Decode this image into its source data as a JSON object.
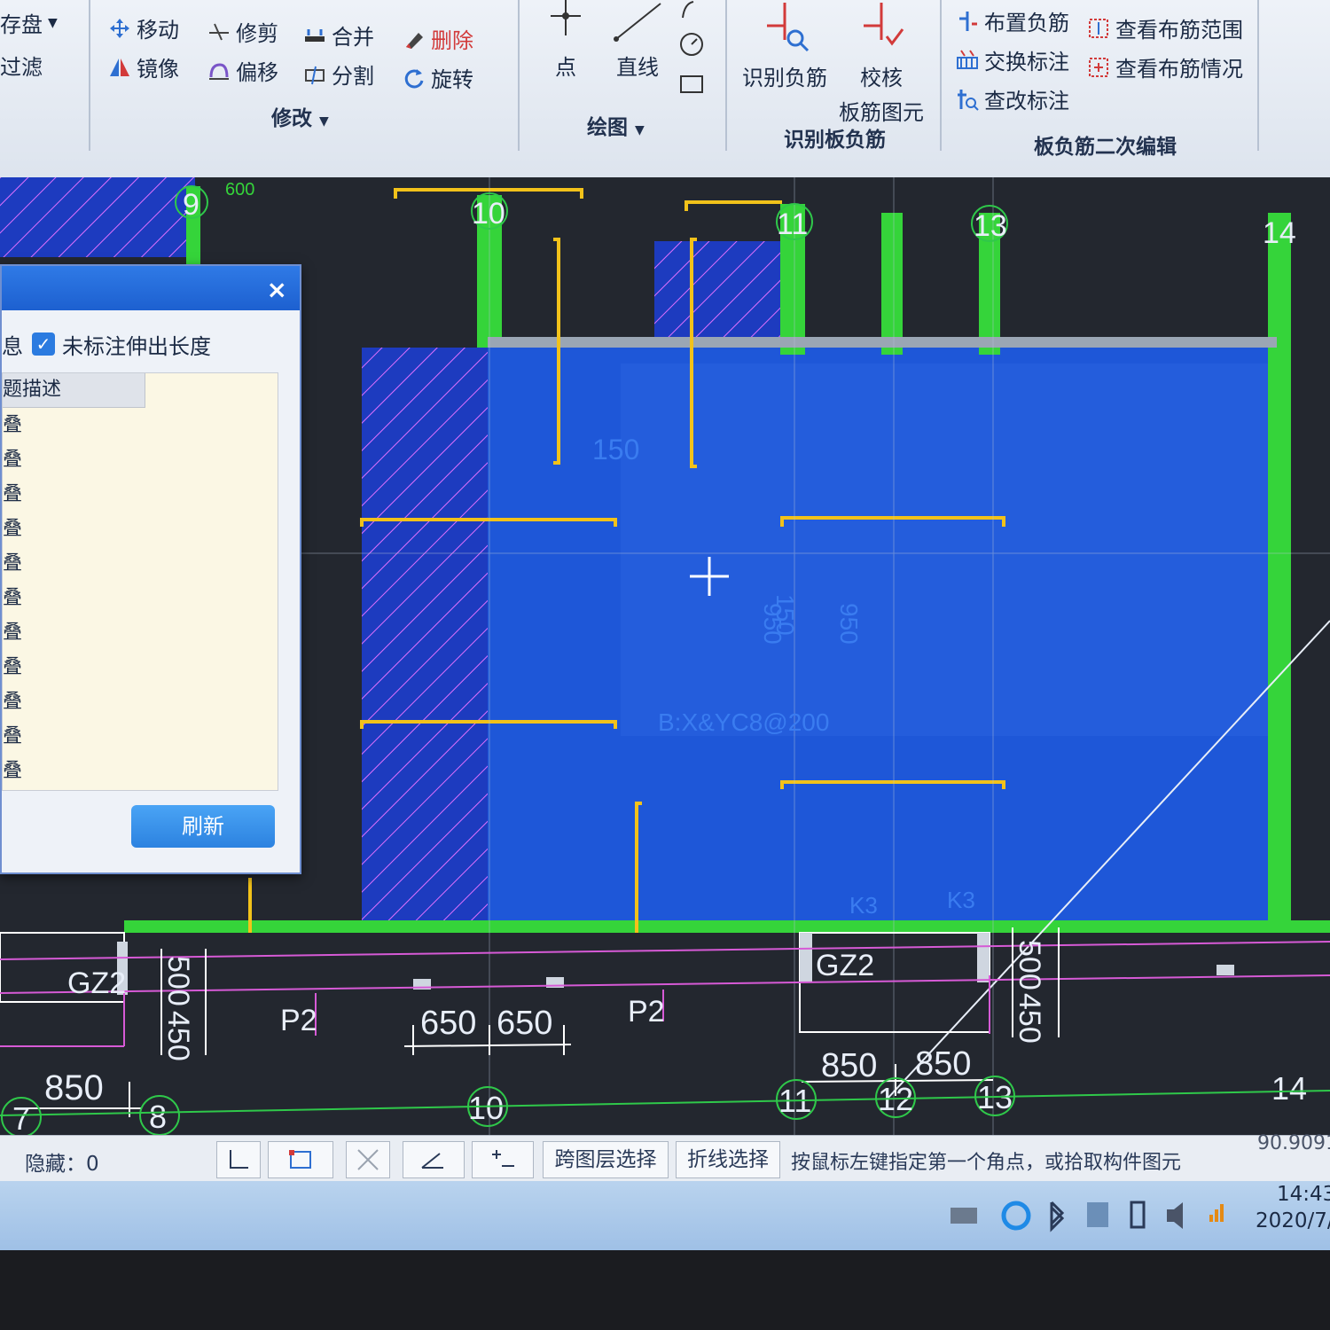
{
  "ribbon": {
    "file_group": {
      "save_label": "存盘",
      "filter_label": "过滤"
    },
    "modify_group": {
      "title": "修改",
      "items": {
        "move": "移动",
        "trim": "修剪",
        "merge": "合并",
        "delete": "删除",
        "mirror": "镜像",
        "offset": "偏移",
        "split": "分割",
        "rotate": "旋转"
      }
    },
    "draw_group": {
      "title": "绘图",
      "point": "点",
      "line": "直线"
    },
    "identify_group": {
      "title": "识别板负筋",
      "identify": "识别负筋",
      "check_line1": "校核",
      "check_line2": "板筋图元"
    },
    "edit_group": {
      "title": "板负筋二次编辑",
      "items": {
        "place": "布置负筋",
        "view_range": "查看布筋范围",
        "swap": "交换标注",
        "view_status": "查看布筋情况",
        "edit_note": "查改标注"
      }
    },
    "colors": {
      "icon_blue": "#2e6fd1",
      "icon_red": "#d23a3a"
    }
  },
  "dialog": {
    "close_glyph": "×",
    "checkbox_label": "未标注伸出长度",
    "checkbox_checked": true,
    "partial_left_label": "息",
    "column_header": "题描述",
    "rows": [
      "叠",
      "叠",
      "叠",
      "叠",
      "叠",
      "叠",
      "叠",
      "叠",
      "叠",
      "叠",
      "叠",
      "叠"
    ],
    "refresh_button": "刷新"
  },
  "cad": {
    "axis_top": [
      "9",
      "10",
      "11",
      "13",
      "14"
    ],
    "axis_bottom": [
      "7",
      "8",
      "10",
      "11",
      "12",
      "13",
      "14"
    ],
    "labels": {
      "gz_left": "GZ2",
      "gz_right": "GZ2",
      "p2_left": "P2",
      "p2_right": "P2",
      "slab_code": "B:X&YC8@200",
      "k3_a": "K3",
      "k3_b": "K3",
      "top_note": "600"
    },
    "dims": {
      "d850_left": "850",
      "d500_left": "500",
      "d450_left": "450",
      "d650_a": "650",
      "d650_b": "650",
      "d850_a": "850",
      "d850_b": "850",
      "d500_right": "500",
      "d450_right": "450",
      "v150": "150",
      "v950": "950",
      "v950b": "950",
      "t150": "150"
    },
    "colors": {
      "slab": "#1e57d8",
      "wall": "#35d43a",
      "rebar": "#f2c21a",
      "dim": "#d65ad6",
      "axis": "#2fc84a",
      "background": "#23272f"
    }
  },
  "statusbar": {
    "hidden_label": "隐藏：0",
    "cross_layer": "跨图层选择",
    "polyline_select": "折线选择",
    "prompt": "按鼠标左键指定第一个角点，或拾取构件图元",
    "coord": "90.9091"
  },
  "taskbar": {
    "time": "14:43",
    "date": "2020/7/"
  }
}
